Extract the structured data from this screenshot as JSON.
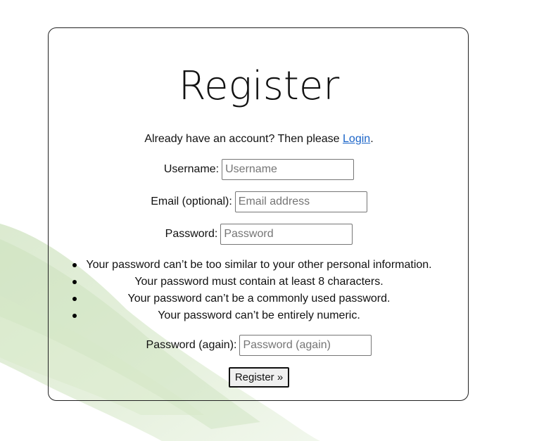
{
  "form": {
    "title": "Register",
    "login_prompt_before": "Already have an account? Then please ",
    "login_link": "Login",
    "login_prompt_after": ".",
    "username": {
      "label": "Username:",
      "placeholder": "Username",
      "value": ""
    },
    "email": {
      "label": "Email (optional):",
      "placeholder": "Email address",
      "value": ""
    },
    "password": {
      "label": "Password:",
      "placeholder": "Password",
      "value": ""
    },
    "password_rules": [
      "Your password can’t be too similar to your other personal information.",
      "Your password must contain at least 8 characters.",
      "Your password can’t be a commonly used password.",
      "Your password can’t be entirely numeric."
    ],
    "password_again": {
      "label": "Password (again):",
      "placeholder": "Password (again)",
      "value": ""
    },
    "submit_label": "Register »"
  },
  "colors": {
    "link": "#1a64c8",
    "background_wash": "#cfe3c0",
    "card_border": "#222222"
  }
}
